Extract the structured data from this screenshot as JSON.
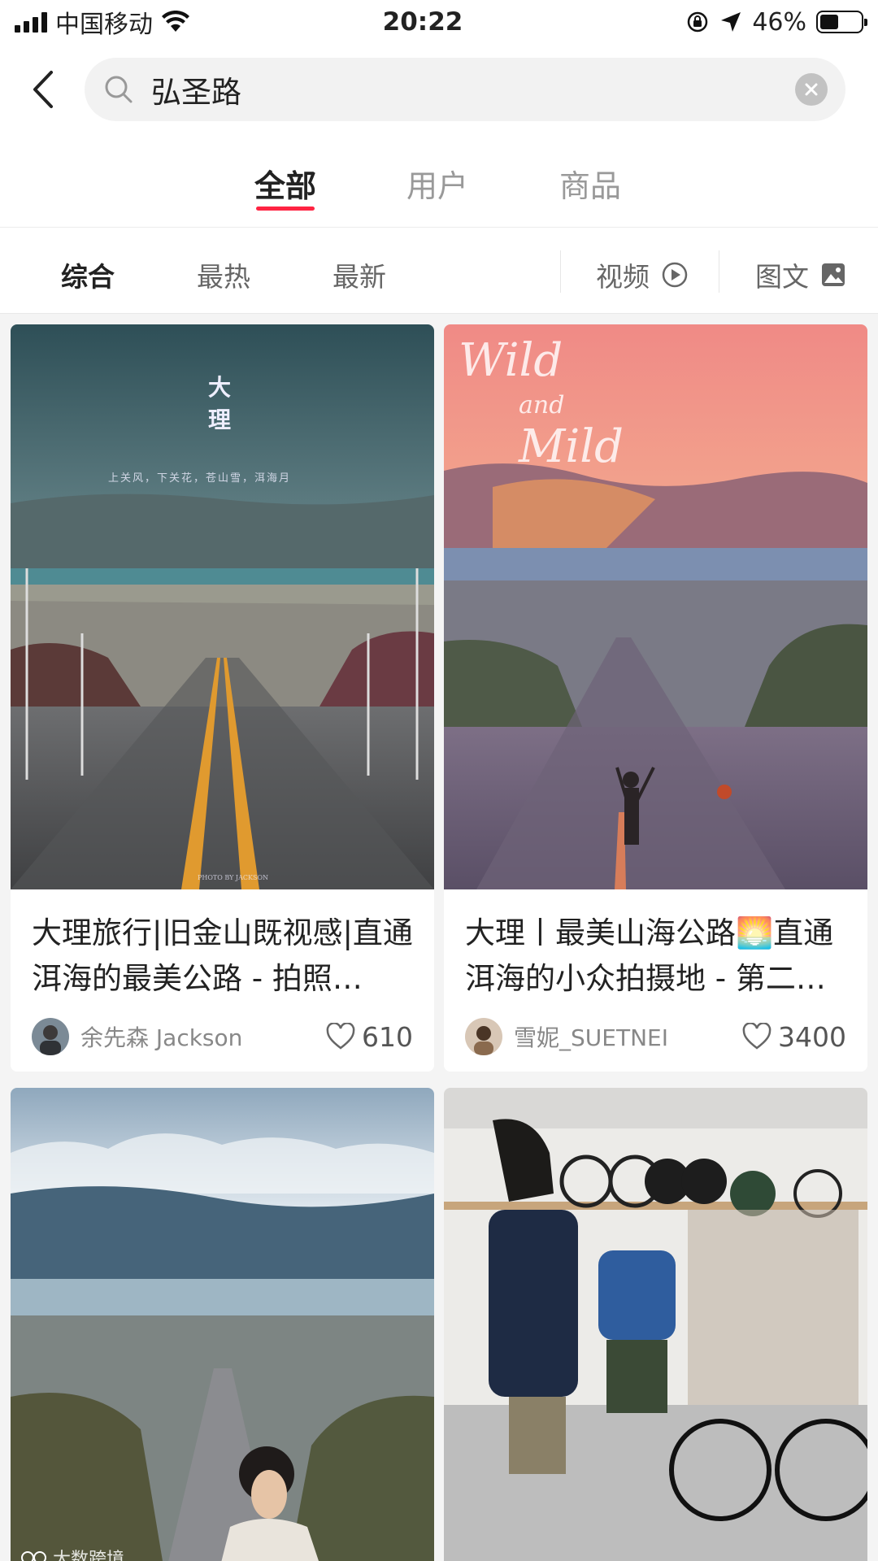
{
  "status_bar": {
    "carrier": "中国移动",
    "time": "20:22",
    "battery_text": "46%",
    "battery_level": 0.46,
    "icons": [
      "signal-icon",
      "wifi-icon",
      "rotation-lock-icon",
      "location-arrow-icon",
      "battery-icon"
    ]
  },
  "search": {
    "value": "弘圣路",
    "icons": [
      "back-arrow-icon",
      "search-icon",
      "clear-icon"
    ]
  },
  "tabs": [
    {
      "label": "全部",
      "active": true
    },
    {
      "label": "用户",
      "active": false
    },
    {
      "label": "商品",
      "active": false
    }
  ],
  "filters": {
    "sort": [
      {
        "label": "综合",
        "active": true
      },
      {
        "label": "最热",
        "active": false
      },
      {
        "label": "最新",
        "active": false
      }
    ],
    "video": {
      "label": "视频",
      "icon": "play-circle-icon"
    },
    "image_text": {
      "label": "图文",
      "icon": "image-icon"
    }
  },
  "cards": [
    {
      "title": "大理旅行|旧金山既视感|直通洱海的最美公路 - 拍照…",
      "author": "余先森 Jackson",
      "likes": "610",
      "image_text": {
        "line1": "大",
        "line2": "理",
        "subtitle": "上关风，下关花，苍山雪，洱海月",
        "credit": "PHOTO BY JACKSON"
      }
    },
    {
      "title": "大理丨最美山海公路🌅直通洱海的小众拍摄地 - 第二…",
      "author": "雪妮_SUETNEI",
      "likes": "3400",
      "image_text": {
        "script1": "Wild",
        "script2": "and",
        "script3": "Mild"
      }
    },
    {
      "title": "",
      "author": "",
      "likes": ""
    },
    {
      "title": "",
      "author": "",
      "likes": ""
    }
  ],
  "watermark": "大数跨境",
  "colors": {
    "accent": "#ff2442",
    "background": "#f4f4f4"
  }
}
